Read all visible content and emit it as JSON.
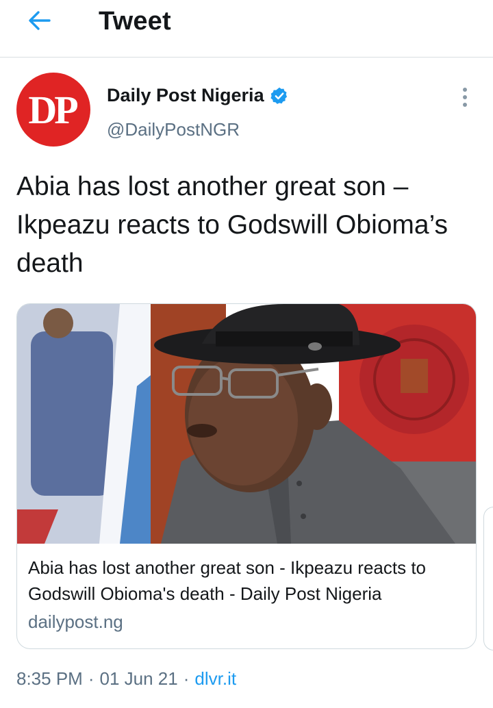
{
  "header": {
    "title": "Tweet",
    "back_icon": "arrow-left-icon"
  },
  "author": {
    "avatar_text": "DP",
    "name": "Daily Post Nigeria",
    "handle": "@DailyPostNGR",
    "verified": true,
    "verified_icon": "verified-badge-icon"
  },
  "tweet": {
    "text": "Abia has lost another great son – Ikpeazu reacts to Godswill Obioma’s death"
  },
  "card": {
    "title": "Abia has lost another great son - Ikpeazu reacts to Godswill Obioma's death - Daily Post Nigeria",
    "domain": "dailypost.ng"
  },
  "meta": {
    "time": "8:35 PM",
    "separator": "·",
    "date": "01 Jun 21",
    "source": "dlvr.it"
  },
  "colors": {
    "accent": "#1d9bf0",
    "avatar_bg": "#e02424",
    "secondary_text": "#5b7083",
    "primary_text": "#14171a"
  }
}
